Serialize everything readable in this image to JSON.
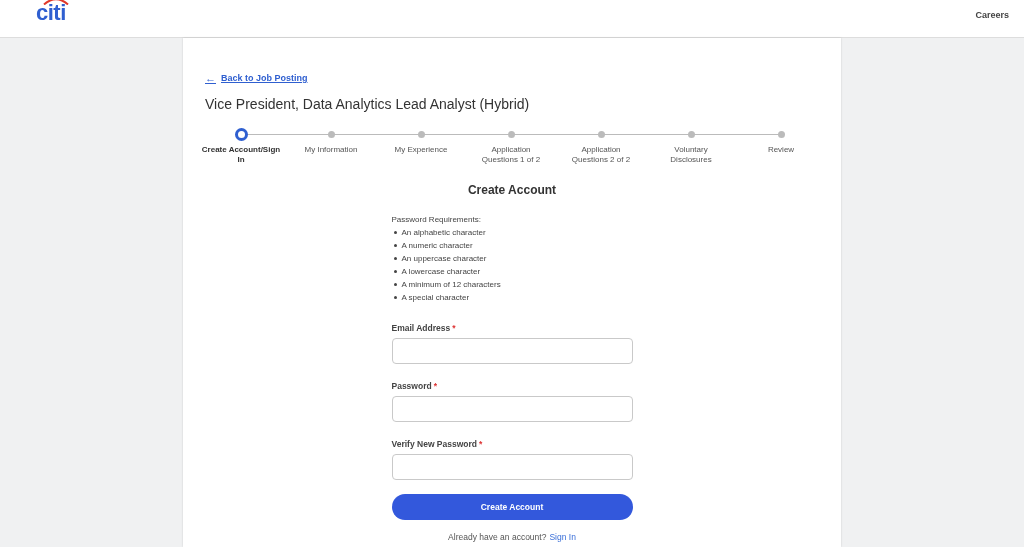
{
  "header": {
    "logo": "citi",
    "nav_link": "Careers"
  },
  "back_link": {
    "arrow": "←",
    "label": "Back to Job Posting"
  },
  "job_title": "Vice President, Data Analytics Lead Analyst (Hybrid)",
  "steps": [
    {
      "label": "Create Account/Sign In",
      "selected": true
    },
    {
      "label": "My Information",
      "selected": false
    },
    {
      "label": "My Experience",
      "selected": false
    },
    {
      "label": "Application Questions 1 of 2",
      "selected": false
    },
    {
      "label": "Application Questions 2 of 2",
      "selected": false
    },
    {
      "label": "Voluntary Disclosures",
      "selected": false
    },
    {
      "label": "Review",
      "selected": false
    }
  ],
  "form": {
    "heading": "Create Account",
    "requirements_title": "Password Requirements:",
    "requirements": [
      "An alphabetic character",
      "A numeric character",
      "An uppercase character",
      "A lowercase character",
      "A minimum of 12 characters",
      "A special character"
    ],
    "fields": [
      {
        "label": "Email Address",
        "asterisk": "*"
      },
      {
        "label": "Password",
        "asterisk": "*"
      },
      {
        "label": "Verify New Password",
        "asterisk": "*"
      }
    ],
    "submit": "Create Account",
    "signin_prompt": "Already have an account?",
    "signin_link": "Sign In"
  }
}
